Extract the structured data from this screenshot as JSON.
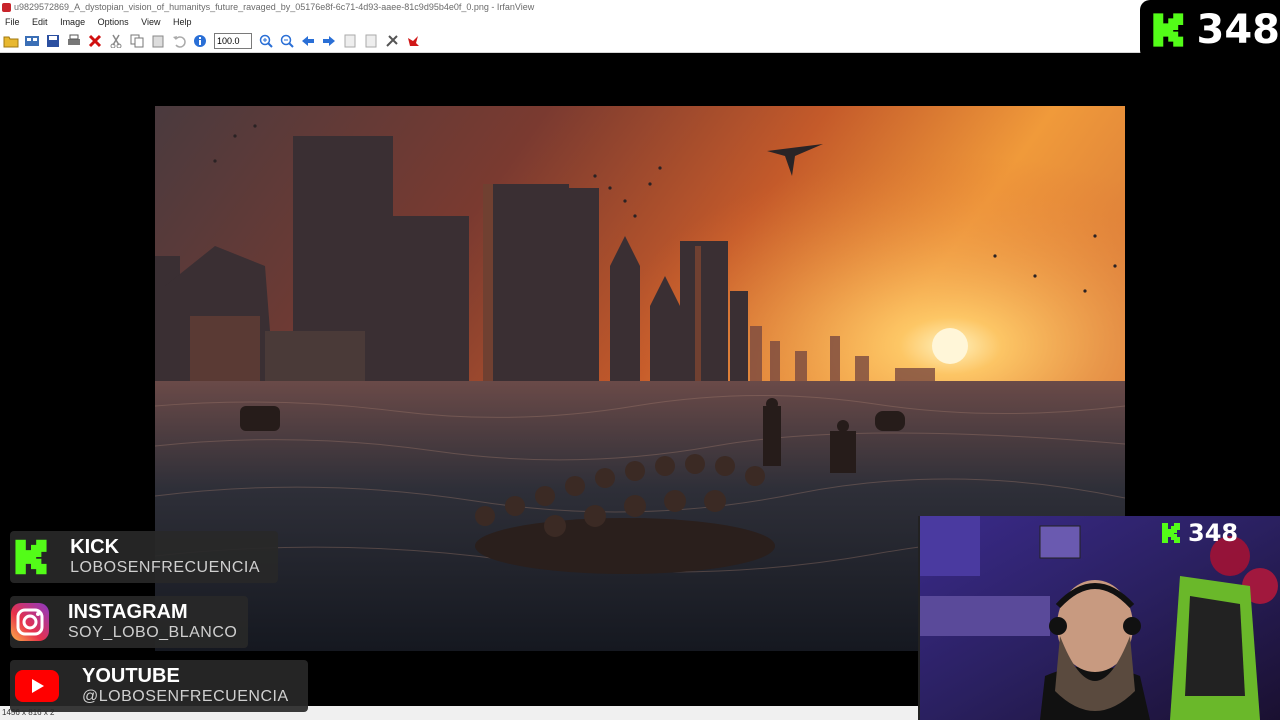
{
  "window": {
    "title": "u9829572869_A_dystopian_vision_of_humanitys_future_ravaged_by_05176e8f-6c71-4d93-aaee-81c9d95b4e0f_0.png - IrfanView"
  },
  "menu": [
    "File",
    "Edit",
    "Image",
    "Options",
    "View",
    "Help"
  ],
  "toolbar": {
    "zoom_value": "100.0",
    "icons": [
      "open-folder-icon",
      "thumbnails-icon",
      "save-icon",
      "print-icon",
      "delete-icon",
      "cut-icon",
      "copy-icon",
      "paste-icon",
      "undo-icon",
      "info-icon",
      "zoom-in-icon",
      "zoom-out-icon",
      "previous-icon",
      "next-icon",
      "first-page-icon",
      "last-page-icon",
      "settings-icon",
      "irfanview-icon"
    ]
  },
  "status": {
    "text": "1456 x 816 x 2"
  },
  "stream": {
    "kick_count": "348",
    "kick_count_cam": "348",
    "socials": [
      {
        "name": "KICK",
        "handle": "LOBOSENFRECUENCIA"
      },
      {
        "name": "INSTAGRAM",
        "handle": "SOY_LOBO_BLANCO"
      },
      {
        "name": "YOUTUBE",
        "handle": "@LOBOSENFRECUENCIA"
      }
    ]
  },
  "colors": {
    "kick_green": "#53fc18",
    "youtube_red": "#ff0000"
  }
}
